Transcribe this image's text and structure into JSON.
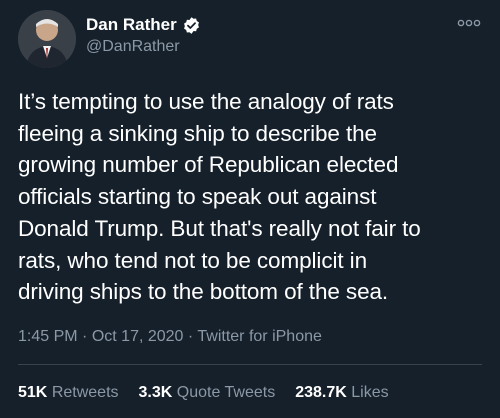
{
  "user": {
    "display_name": "Dan Rather",
    "handle": "@DanRather",
    "verified": true,
    "avatar_icon": "profile-photo"
  },
  "tweet": {
    "text": "It’s tempting to use the analogy of rats\nfleeing a sinking ship to describe the\ngrowing number of Republican elected\nofficials starting to speak out against\nDonald Trump. But that's really not fair to\nrats, who tend not to be complicit in\ndriving ships to the bottom of the sea.",
    "time": "1:45 PM",
    "date": "Oct 17, 2020",
    "source": "Twitter for iPhone",
    "separator": "·"
  },
  "stats": {
    "retweets_count": "51K",
    "retweets_label": "Retweets",
    "quotes_count": "3.3K",
    "quotes_label": "Quote Tweets",
    "likes_count": "238.7K",
    "likes_label": "Likes"
  },
  "icons": {
    "verified": "verified-badge-icon",
    "more": "more-options-icon"
  },
  "colors": {
    "background": "#15202b",
    "primary_text": "#ffffff",
    "secondary_text": "#8b98a5",
    "divider": "#38444d"
  }
}
